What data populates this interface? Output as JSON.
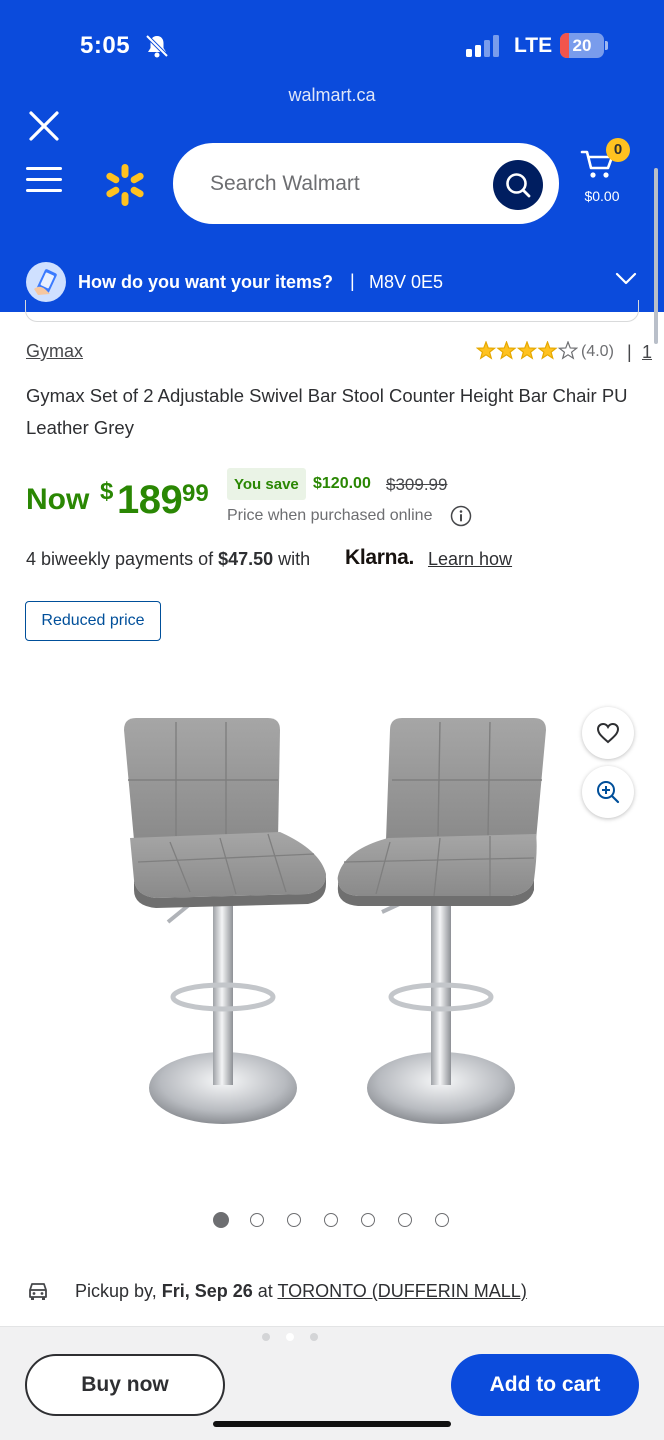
{
  "status_bar": {
    "time": "5:05",
    "network": "LTE",
    "battery": "20",
    "battery_level_percent": 20
  },
  "browser": {
    "url": "walmart.ca"
  },
  "header": {
    "search_placeholder": "Search Walmart",
    "cart_count": "0",
    "cart_total": "$0.00",
    "fulfillment_question": "How do you want your items?",
    "fulfillment_separator": "|",
    "postal_code": "M8V 0E5",
    "brand_color": "#0b4bdc",
    "spark_color": "#ffc220"
  },
  "product": {
    "brand": "Gymax",
    "rating_stars": 4.0,
    "rating_label": "(4.0)",
    "rating_separator": "|",
    "review_count": "1",
    "title": "Gymax Set of 2 Adjustable Swivel Bar Stool Counter Height Bar Chair PU Leather Grey",
    "price": {
      "now_label": "Now",
      "currency": "$",
      "dollars": "189",
      "cents": "99",
      "you_save_label": "You save",
      "save_amount": "$120.00",
      "was_price": "$309.99",
      "note": "Price when purchased online",
      "price_color": "#2a8703"
    },
    "klarna": {
      "prefix": "4 biweekly payments of ",
      "amount": "$47.50",
      "suffix": " with",
      "logo": "Klarna.",
      "link": "Learn how"
    },
    "badge": "Reduced price",
    "image_count": 7,
    "active_image_index": 0
  },
  "pickup": {
    "prefix": "Pickup by, ",
    "date": "Fri, Sep 26",
    "middle": " at ",
    "store": "TORONTO (DUFFERIN MALL)"
  },
  "actions": {
    "buy_now": "Buy now",
    "add_to_cart": "Add to cart"
  },
  "icons": {
    "bell": "bell-slash-icon",
    "close": "close-icon",
    "menu": "hamburger-menu-icon",
    "spark": "walmart-spark-icon",
    "search": "search-icon",
    "cart": "cart-icon",
    "fulfillment": "delivery-phone-icon",
    "chevron": "chevron-down-icon",
    "heart": "heart-icon",
    "zoom": "zoom-in-icon",
    "info": "info-icon",
    "car": "car-icon"
  }
}
